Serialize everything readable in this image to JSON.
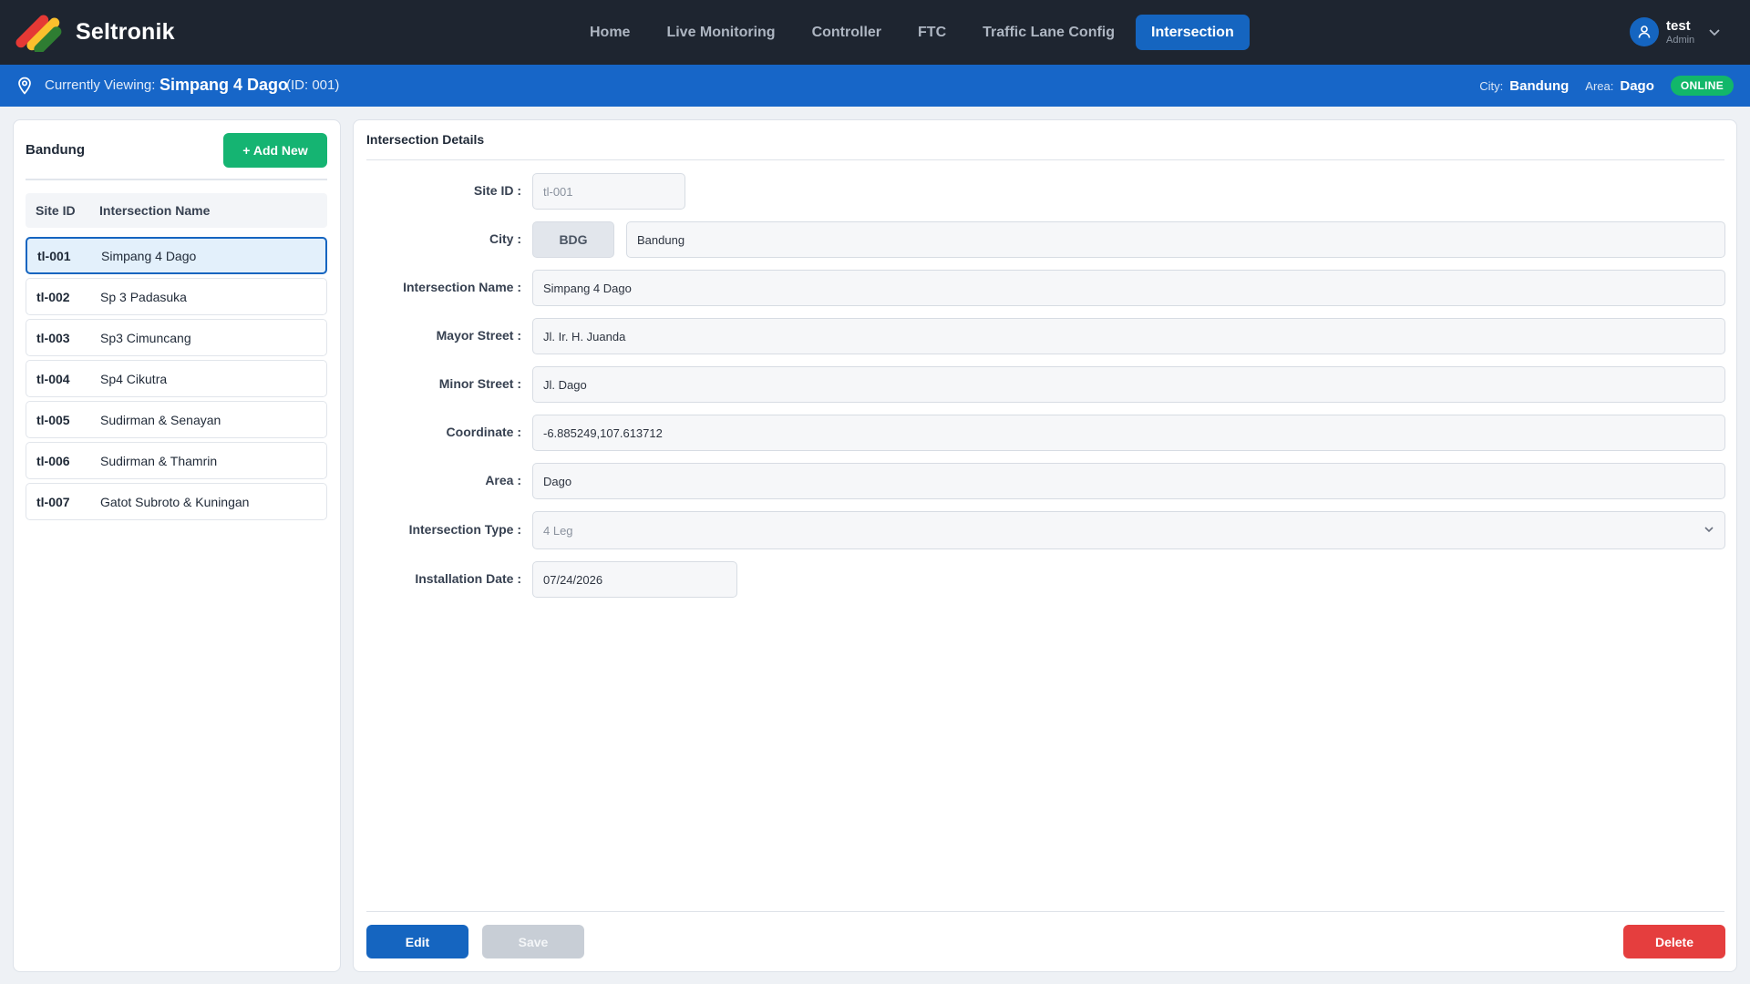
{
  "brand": {
    "name": "Seltronik",
    "logo_colors": [
      "#e53935",
      "#fbc02d",
      "#2e7d32"
    ]
  },
  "nav": {
    "items": [
      {
        "label": "Home"
      },
      {
        "label": "Live Monitoring"
      },
      {
        "label": "Controller"
      },
      {
        "label": "FTC"
      },
      {
        "label": "Traffic Lane Config"
      },
      {
        "label": "Intersection",
        "active": true
      }
    ]
  },
  "user": {
    "name": "test",
    "role": "Admin",
    "icon": "user-icon"
  },
  "context": {
    "label": "Currently Viewing:",
    "name": "Simpang 4 Dago",
    "id_text": "(ID: 001)",
    "city_key": "City:",
    "city_val": "Bandung",
    "area_key": "Area:",
    "area_val": "Dago",
    "status": "ONLINE",
    "status_color": "#12b76a"
  },
  "sidebar": {
    "title": "Bandung",
    "add_label": "+ Add New",
    "columns": [
      "Site ID",
      "Intersection Name"
    ],
    "rows": [
      {
        "id": "tl-001",
        "name": "Simpang 4 Dago",
        "selected": true
      },
      {
        "id": "tl-002",
        "name": "Sp 3 Padasuka"
      },
      {
        "id": "tl-003",
        "name": "Sp3 Cimuncang"
      },
      {
        "id": "tl-004",
        "name": "Sp4 Cikutra"
      },
      {
        "id": "tl-005",
        "name": "Sudirman & Senayan"
      },
      {
        "id": "tl-006",
        "name": "Sudirman & Thamrin"
      },
      {
        "id": "tl-007",
        "name": "Gatot Subroto & Kuningan"
      }
    ]
  },
  "details": {
    "title": "Intersection Details",
    "site_id": {
      "label": "Site ID :",
      "value": "tl-001"
    },
    "city": {
      "label": "City :",
      "code": "BDG",
      "value": "Bandung"
    },
    "intersection_name": {
      "label": "Intersection Name :",
      "value": "Simpang 4 Dago"
    },
    "mayor_street": {
      "label": "Mayor Street :",
      "value": "Jl. Ir. H. Juanda"
    },
    "minor_street": {
      "label": "Minor Street :",
      "value": "Jl. Dago"
    },
    "coordinate": {
      "label": "Coordinate :",
      "value": "-6.885249,107.613712"
    },
    "area": {
      "label": "Area :",
      "value": "Dago"
    },
    "intersection_type": {
      "label": "Intersection Type :",
      "value": "4 Leg"
    },
    "installation_date": {
      "label": "Installation Date :",
      "value": "07/24/2026"
    }
  },
  "actions": {
    "edit": "Edit",
    "save": "Save",
    "delete": "Delete"
  }
}
